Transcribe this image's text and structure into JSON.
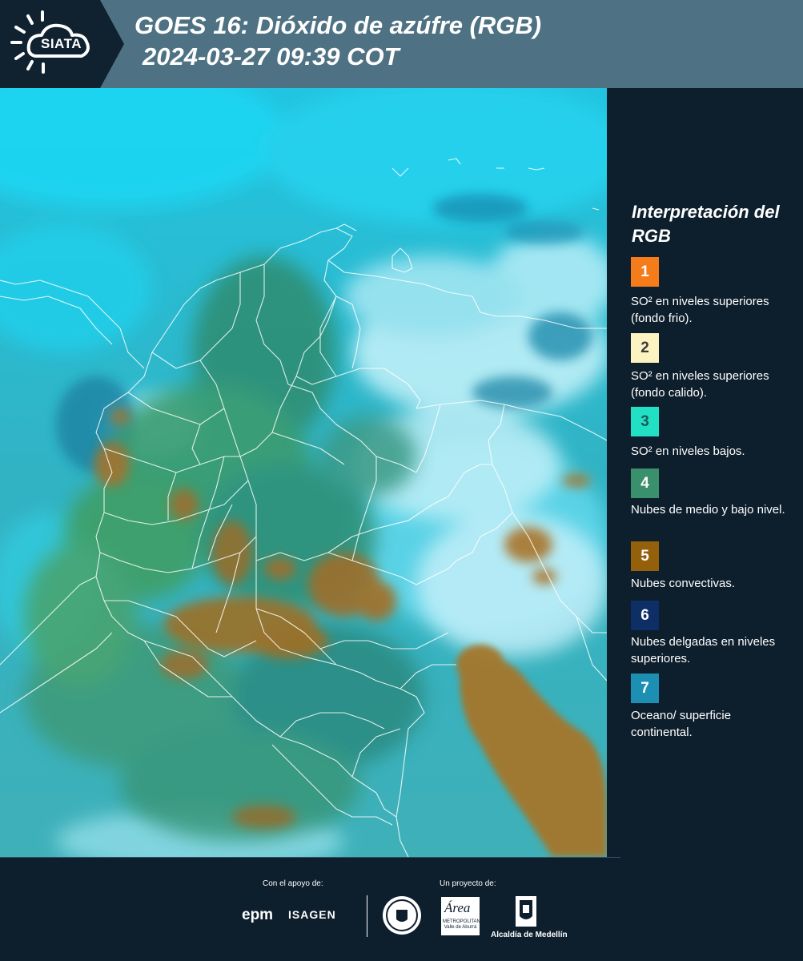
{
  "header": {
    "logo_text": "SIATA",
    "title_line1": "GOES 16: Dióxido de azúfre (RGB)",
    "title_line2": "2024-03-27 09:39 COT",
    "background_color": "#4e7283"
  },
  "legend": {
    "title": "Interpretación del RGB",
    "items": [
      {
        "number": "1",
        "label": "SO² en niveles superiores (fondo frio).",
        "color": "#f47c1a"
      },
      {
        "number": "2",
        "label": "SO² en niveles superiores (fondo calido).",
        "color": "#fdf3c0"
      },
      {
        "number": "3",
        "label": "SO² en niveles bajos.",
        "color": "#22e0c4"
      },
      {
        "number": "4",
        "label": "Nubes de medio y bajo nivel.",
        "color": "#3a8f6c"
      },
      {
        "number": "5",
        "label": "Nubes convectivas.",
        "color": "#94600c"
      },
      {
        "number": "6",
        "label": "Nubes delgadas en niveles superiores.",
        "color": "#0d2f66"
      },
      {
        "number": "7",
        "label": "Oceano/ superficie continental.",
        "color": "#1d8fb2"
      }
    ]
  },
  "footer": {
    "support_label": "Con el apoyo de:",
    "project_label": "Un proyecto de:",
    "epm_logo_text": "epm",
    "isagen_logo_text": "ISAGEN",
    "area_logo_text": "Área",
    "area_logo_subtext": "METROPOLITANA Valle de Aburrá",
    "alcaldia_logo_text": "Alcaldía de Medellín"
  }
}
